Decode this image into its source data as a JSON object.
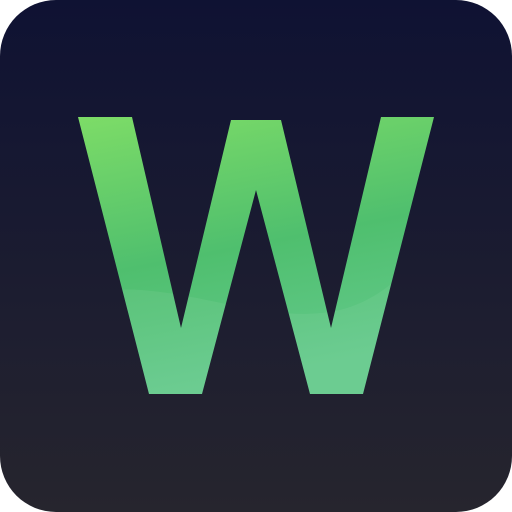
{
  "app_icon": {
    "letter": "W",
    "colors": {
      "background_top": "#0f1233",
      "background_bottom": "#26252e",
      "glyph_top": "#7ddc67",
      "glyph_mid": "#4fbf6e",
      "glyph_bottom": "#63c98b"
    }
  }
}
